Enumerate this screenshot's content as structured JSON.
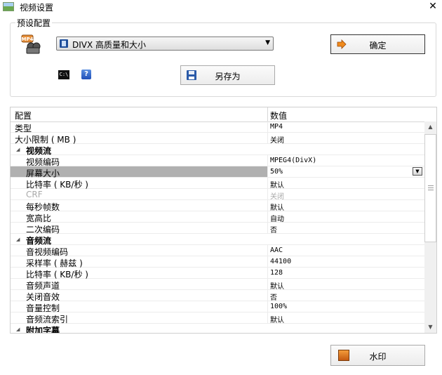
{
  "window": {
    "title": "视频设置",
    "close_glyph": "✕"
  },
  "preset": {
    "legend": "预设配置",
    "selected": "DIVX 高质量和大小",
    "format_icon_text": "MP4",
    "dropdown_glyph": "▼"
  },
  "buttons": {
    "ok": "确定",
    "save_as": "另存为",
    "watermark": "水印",
    "cmd_icon_text": "C:\\",
    "help_icon_text": "?"
  },
  "grid": {
    "header_name": "配置",
    "header_value": "数值",
    "rows": [
      {
        "type": "top",
        "name": "类型",
        "value": "MP4"
      },
      {
        "type": "top",
        "name": "大小限制 ( MB )",
        "value": "关闭"
      },
      {
        "type": "cat",
        "name": "视频流",
        "caret": "◢"
      },
      {
        "type": "item",
        "name": "视频编码",
        "value": "MPEG4(DivX)"
      },
      {
        "type": "item",
        "name": "屏幕大小",
        "value": "50%",
        "selected": true,
        "dropdown": "▼"
      },
      {
        "type": "item",
        "name": "比特率 ( KB/秒 )",
        "value": "默认"
      },
      {
        "type": "item",
        "name": "CRF",
        "value": "关闭",
        "disabled": true
      },
      {
        "type": "item",
        "name": "每秒帧数",
        "value": "默认"
      },
      {
        "type": "item",
        "name": "宽高比",
        "value": "自动"
      },
      {
        "type": "item",
        "name": "二次编码",
        "value": "否"
      },
      {
        "type": "cat",
        "name": "音频流",
        "caret": "◢"
      },
      {
        "type": "item",
        "name": "音视频编码",
        "value": "AAC"
      },
      {
        "type": "item",
        "name": "采样率 ( 赫兹 )",
        "value": "44100"
      },
      {
        "type": "item",
        "name": "比特率 ( KB/秒 )",
        "value": "128"
      },
      {
        "type": "item",
        "name": "音频声道",
        "value": "默认"
      },
      {
        "type": "item",
        "name": "关闭音效",
        "value": "否"
      },
      {
        "type": "item",
        "name": "音量控制",
        "value": "100%"
      },
      {
        "type": "item",
        "name": "音频流索引",
        "value": "默认"
      },
      {
        "type": "cat",
        "name": "附加字幕",
        "caret": "◢"
      }
    ],
    "scroll_up_glyph": "▲",
    "scroll_down_glyph": "▼"
  },
  "colors": {
    "selected_row": "#b0b0b0",
    "disabled_text": "#aaaaaa",
    "ok_arrow": "#f08a1c"
  }
}
